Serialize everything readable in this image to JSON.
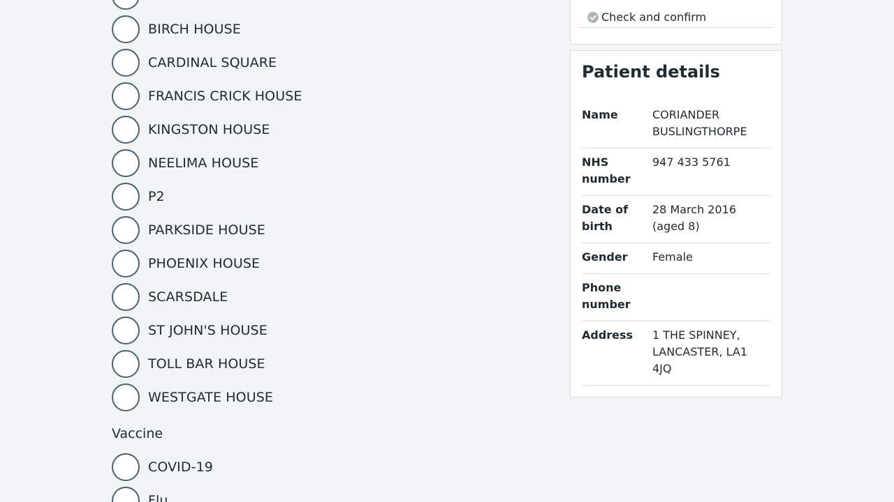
{
  "locations": {
    "options": [
      "BIRCH HOUSE",
      "CARDINAL SQUARE",
      "FRANCIS CRICK HOUSE",
      "KINGSTON HOUSE",
      "NEELIMA HOUSE",
      "P2",
      "PARKSIDE HOUSE",
      "PHOENIX HOUSE",
      "SCARSDALE",
      "ST JOHN'S HOUSE",
      "TOLL BAR HOUSE",
      "WESTGATE HOUSE"
    ]
  },
  "vaccine": {
    "heading": "Vaccine",
    "options": [
      "COVID-19",
      "Flu"
    ]
  },
  "steps": {
    "check_confirm": {
      "label": "Check and confirm",
      "icon": "check-circle-icon"
    }
  },
  "patient": {
    "title": "Patient details",
    "rows": [
      {
        "key": "Name",
        "value": "CORIANDER BUSLINGTHORPE"
      },
      {
        "key": "NHS number",
        "value": "947 433 5761"
      },
      {
        "key": "Date of birth",
        "value": "28 March 2016 (aged 8)"
      },
      {
        "key": "Gender",
        "value": "Female"
      },
      {
        "key": "Phone number",
        "value": ""
      },
      {
        "key": "Address",
        "value": "1 THE SPINNEY, LANCASTER, LA1 4JQ"
      }
    ]
  },
  "colors": {
    "background": "#f0f4f5",
    "text": "#212b32",
    "radio_border": "#4c6272",
    "border": "#d8dde0",
    "check_icon": "#aeb7bd"
  }
}
